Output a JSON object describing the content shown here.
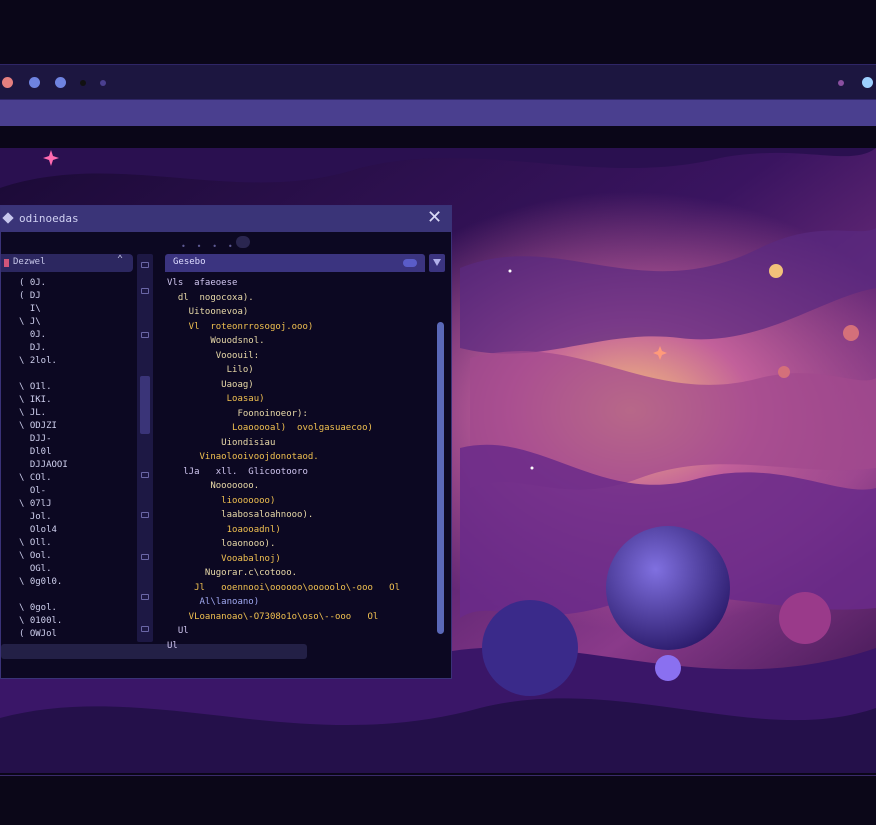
{
  "window_dots": [
    {
      "color": "#e57f7f"
    },
    {
      "color": "#6f83e0"
    },
    {
      "color": "#6f83e0"
    },
    {
      "color": "#111111"
    },
    {
      "color": "#4a3f8f"
    },
    {
      "color": "#8a4fa0"
    },
    {
      "color": "#9dd0ff"
    }
  ],
  "editor": {
    "title": "odinoedas",
    "sidebar_header": "Dezwel",
    "tab_label": "Gesebo",
    "sidebar_lines": [
      "( 0J.",
      "( DJ",
      "  I\\",
      "\\ J\\",
      "  0J.",
      "  DJ.",
      "\\ 2lol.",
      "",
      "\\ O1l.",
      "\\ IKI.",
      "\\ JL.",
      "\\ ODJZI",
      "  DJJ-",
      "  Dl0l",
      "  DJJAOOI",
      "\\ COl.",
      "  Ol-",
      "\\ 07lJ",
      "  Jol.",
      "  Olol4",
      "\\ Oll.",
      "\\ Ool.",
      "  OGl.",
      "\\ 0g0l0.",
      "",
      "\\ 0gol.",
      "\\ 0100l.",
      "( OWJol"
    ],
    "code_lines": [
      {
        "text": "Vls  afaeoese",
        "color": "#d0c6f0"
      },
      {
        "text": "  dl  nogocoxa).",
        "color": "#e8d9a8"
      },
      {
        "text": "    Uitoonevoa)",
        "color": "#e8d9a8"
      },
      {
        "text": "    Vl  roteonrrosogoj.ooo)",
        "color": "#f0c050"
      },
      {
        "text": "        Wouodsnol.",
        "color": "#e8d9a8"
      },
      {
        "text": "         Vooouil:",
        "color": "#e8d9a8"
      },
      {
        "text": "           Lilo)",
        "color": "#e8d9a8"
      },
      {
        "text": "          Uaoag)",
        "color": "#e8d9a8"
      },
      {
        "text": "           Loasau)",
        "color": "#f0c050"
      },
      {
        "text": "             Foonoinoeor):",
        "color": "#e8d9a8"
      },
      {
        "text": "            Loaooooal)  ovolgasuaecoo)",
        "color": "#f0c050"
      },
      {
        "text": "          Uiondisiau",
        "color": "#e8d9a8"
      },
      {
        "text": "      Vinaolooivoojdonotaod.",
        "color": "#f0c050"
      },
      {
        "text": "   lJa   xll.  Glicootooro",
        "color": "#d0c6f0"
      },
      {
        "text": "        Nooooooo.",
        "color": "#e8d9a8"
      },
      {
        "text": "          liooooooo)",
        "color": "#f0c050"
      },
      {
        "text": "          laabosaloahnooo).",
        "color": "#e8d9a8"
      },
      {
        "text": "           1oaooadnl)",
        "color": "#f0c050"
      },
      {
        "text": "          loaonooo).",
        "color": "#e8d9a8"
      },
      {
        "text": "          Vooabalnoj)",
        "color": "#f0c050"
      },
      {
        "text": "       Nugorar.c\\cotooo.",
        "color": "#e8d9a8"
      },
      {
        "text": "     Jl   ooennooi\\oooooo\\ooooolo\\-ooo   Ol",
        "color": "#f0c050"
      },
      {
        "text": "      Al\\lanoano)",
        "color": "#a0a8f0"
      },
      {
        "text": "    VLoananoao\\-O7308o1o\\oso\\--ooo   Ol",
        "color": "#f0c050"
      },
      {
        "text": "  Ul",
        "color": "#d0c6f0"
      },
      {
        "text": "Ul",
        "color": "#d0c6f0"
      }
    ]
  },
  "colors": {
    "background": "#0a0618",
    "accent": "#3b3480",
    "scrollbar": "#5a68b8"
  }
}
